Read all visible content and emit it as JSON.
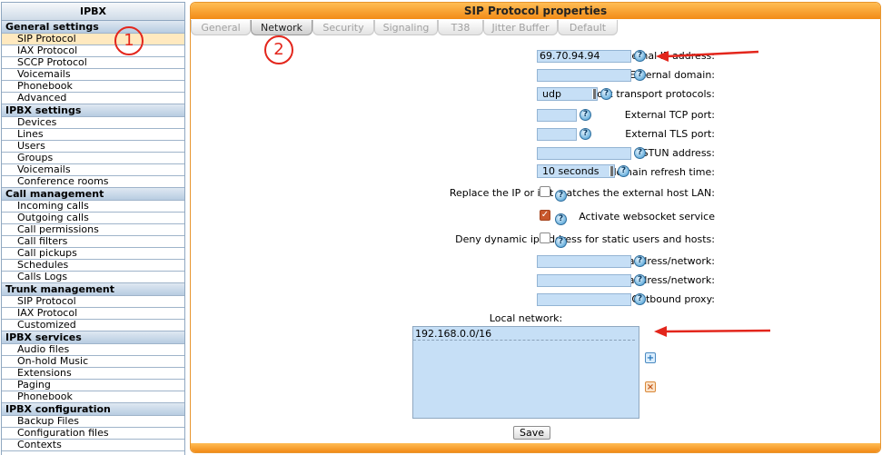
{
  "sidebar": {
    "title": "IPBX",
    "sections": [
      {
        "title": "General settings",
        "items": [
          "SIP Protocol",
          "IAX Protocol",
          "SCCP Protocol",
          "Voicemails",
          "Phonebook",
          "Advanced"
        ]
      },
      {
        "title": "IPBX settings",
        "items": [
          "Devices",
          "Lines",
          "Users",
          "Groups",
          "Voicemails",
          "Conference rooms"
        ]
      },
      {
        "title": "Call management",
        "items": [
          "Incoming calls",
          "Outgoing calls",
          "Call permissions",
          "Call filters",
          "Call pickups",
          "Schedules",
          "Calls Logs"
        ]
      },
      {
        "title": "Trunk management",
        "items": [
          "SIP Protocol",
          "IAX Protocol",
          "Customized"
        ]
      },
      {
        "title": "IPBX services",
        "items": [
          "Audio files",
          "On-hold Music",
          "Extensions",
          "Paging",
          "Phonebook"
        ]
      },
      {
        "title": "IPBX configuration",
        "items": [
          "Backup Files",
          "Configuration files",
          "Contexts"
        ]
      }
    ],
    "active_item": "SIP Protocol"
  },
  "main": {
    "title": "SIP Protocol properties",
    "tabs": [
      "General",
      "Network",
      "Security",
      "Signaling",
      "T38",
      "Jitter Buffer",
      "Default"
    ],
    "active_tab": "Network"
  },
  "form": {
    "external_ip": {
      "label": "External IP address:",
      "value": "69.70.94.94"
    },
    "external_domain": {
      "label": "External domain:",
      "value": ""
    },
    "transport": {
      "label": "Network transport protocols:",
      "value": "udp"
    },
    "tcp_port": {
      "label": "External TCP port:",
      "value": ""
    },
    "tls_port": {
      "label": "External TLS port:",
      "value": ""
    },
    "stun": {
      "label": "STUN address:",
      "value": ""
    },
    "refresh": {
      "label": "External domain refresh time:",
      "value": "10 seconds"
    },
    "replace_ip": {
      "label": "Replace the IP or if it matches the external host LAN:",
      "checked": false
    },
    "websocket": {
      "label": "Activate websocket service",
      "checked": true
    },
    "deny_dynamic": {
      "label": "Deny dynamic ip address for static users and hosts:",
      "checked": false
    },
    "denied": {
      "label": "Denied address/network:",
      "value": ""
    },
    "allowed": {
      "label": "Allowed address/network:",
      "value": ""
    },
    "outbound_proxy": {
      "label": "Outbound proxy:",
      "value": ""
    },
    "local_network": {
      "label": "Local network:",
      "entries": [
        "192.168.0.0/16"
      ]
    },
    "save_label": "Save"
  },
  "annotations": {
    "marker_1": "1",
    "marker_2": "2",
    "color": "#e3261c"
  },
  "icons": {
    "help": "help-icon",
    "add": "add-icon",
    "delete": "delete-icon",
    "check": "check-icon"
  },
  "colors": {
    "accent_orange": "#f28b16",
    "input_blue": "#c6dff6",
    "sidebar_header": "#b7cce1"
  }
}
